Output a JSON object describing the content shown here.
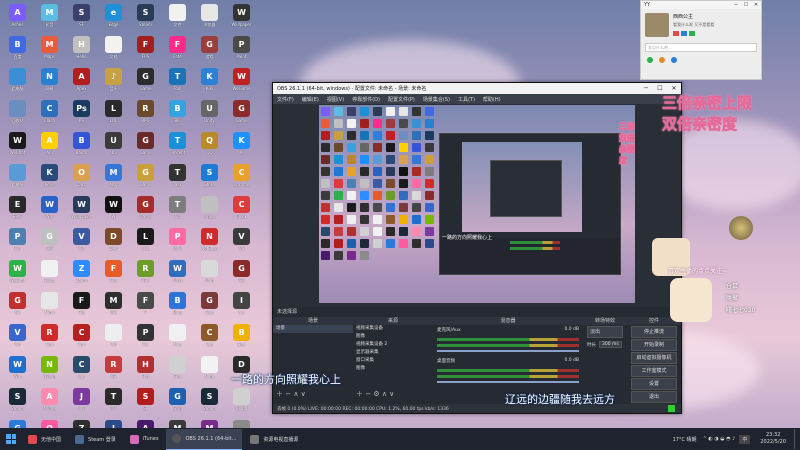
{
  "desktop_icons": [
    {
      "label": "Ashes",
      "color": "#7a5cff",
      "glyph": "A"
    },
    {
      "label": "初音",
      "color": "#5bbde2",
      "glyph": "M"
    },
    {
      "label": "SF",
      "color": "#3a3f6b",
      "glyph": "S"
    },
    {
      "label": "Edge",
      "color": "#1f8fd6",
      "glyph": "e"
    },
    {
      "label": "Steam",
      "color": "#2a3c55",
      "glyph": "S"
    },
    {
      "label": "文件",
      "color": "#f1f1f1",
      "glyph": ""
    },
    {
      "label": "浏览器",
      "color": "#e6e6e6",
      "glyph": ""
    },
    {
      "label": "Wallpaper",
      "color": "#333",
      "glyph": "W"
    },
    {
      "label": "百度",
      "color": "#4169e1",
      "glyph": "B"
    },
    {
      "label": "Maps",
      "color": "#e85b3c",
      "glyph": "M"
    },
    {
      "label": "Hello",
      "color": "#c0c0c0",
      "glyph": "H"
    },
    {
      "label": "文档",
      "color": "#f2f2f2",
      "glyph": ""
    },
    {
      "label": "FPS",
      "color": "#a02020",
      "glyph": "F"
    },
    {
      "label": "Fate",
      "color": "#ff2b8a",
      "glyph": "F"
    },
    {
      "label": "游戏",
      "color": "#9b3d3d",
      "glyph": "G"
    },
    {
      "label": "Paint",
      "color": "#4a4a4a",
      "glyph": "P"
    },
    {
      "label": "此电脑",
      "color": "#3c8fd6",
      "glyph": ""
    },
    {
      "label": "网易",
      "color": "#2a7fd1",
      "glyph": "N"
    },
    {
      "label": "Apex",
      "color": "#b21e1e",
      "glyph": "A"
    },
    {
      "label": "音乐",
      "color": "#c7a043",
      "glyph": "♪"
    },
    {
      "label": "Game",
      "color": "#2c2c2c",
      "glyph": "G"
    },
    {
      "label": "Tool",
      "color": "#1a73b8",
      "glyph": "T"
    },
    {
      "label": "Kiki",
      "color": "#2e7fd6",
      "glyph": "K"
    },
    {
      "label": "WeGame",
      "color": "#c02020",
      "glyph": "W"
    },
    {
      "label": "回收站",
      "color": "#6c8dbf",
      "glyph": ""
    },
    {
      "label": "Clash",
      "color": "#2d6fb8",
      "glyph": "C"
    },
    {
      "label": "PS",
      "color": "#1a3a5e",
      "glyph": "Ps"
    },
    {
      "label": "LOL",
      "color": "#2a2a2a",
      "glyph": "L"
    },
    {
      "label": "RPG",
      "color": "#6a4a2a",
      "glyph": "R"
    },
    {
      "label": "Bili",
      "color": "#36a3e0",
      "glyph": "B"
    },
    {
      "label": "Unity",
      "color": "#666",
      "glyph": "U"
    },
    {
      "label": "Game",
      "color": "#8c2b2b",
      "glyph": "G"
    },
    {
      "label": "WeChat",
      "color": "#1a1a1a",
      "glyph": "W"
    },
    {
      "label": "Ani",
      "color": "#ffd000",
      "glyph": "A"
    },
    {
      "label": "Baidu",
      "color": "#3555d9",
      "glyph": "B"
    },
    {
      "label": "Ubi",
      "color": "#3a3a3a",
      "glyph": "U"
    },
    {
      "label": "Game",
      "color": "#6b2a2a",
      "glyph": "G"
    },
    {
      "label": "Tencent",
      "color": "#1b8fd8",
      "glyph": "T"
    },
    {
      "label": "QQ",
      "color": "#b88a2a",
      "glyph": "Q"
    },
    {
      "label": "K",
      "color": "#1e90ff",
      "glyph": "K"
    },
    {
      "label": "此电脑",
      "color": "#5a9bd6",
      "glyph": ""
    },
    {
      "label": "Keys",
      "color": "#2a4a7a",
      "glyph": "K"
    },
    {
      "label": "Oriz",
      "color": "#d8a050",
      "glyph": "O"
    },
    {
      "label": "Msg",
      "color": "#3477d9",
      "glyph": "M"
    },
    {
      "label": "Game",
      "color": "#c9a03a",
      "glyph": "G"
    },
    {
      "label": "Task",
      "color": "#333",
      "glyph": "T"
    },
    {
      "label": "Store",
      "color": "#1f7ad6",
      "glyph": "S"
    },
    {
      "label": "Chrome",
      "color": "#e9a12b",
      "glyph": "C"
    },
    {
      "label": "EPIC",
      "color": "#2a2a2a",
      "glyph": "E"
    },
    {
      "label": "Win",
      "color": "#2962c7",
      "glyph": "W"
    },
    {
      "label": "Wallpaper",
      "color": "#2a3a5a",
      "glyph": "W"
    },
    {
      "label": "W",
      "color": "#111",
      "glyph": "W"
    },
    {
      "label": "Game",
      "color": "#a62b2b",
      "glyph": "G"
    },
    {
      "label": "Toc",
      "color": "#7d7d7d",
      "glyph": "T"
    },
    {
      "label": "Apps",
      "color": "#bfbfbf",
      "glyph": ""
    },
    {
      "label": "Clock",
      "color": "#dc3c3c",
      "glyph": "C"
    },
    {
      "label": "Pic",
      "color": "#4e7fb3",
      "glyph": "P"
    },
    {
      "label": "GW",
      "color": "#c0c0c0",
      "glyph": "G"
    },
    {
      "label": "Vis",
      "color": "#3c5aa0",
      "glyph": "V"
    },
    {
      "label": "Dev",
      "color": "#7a4a2a",
      "glyph": "D"
    },
    {
      "label": "LOL",
      "color": "#1a1a1a",
      "glyph": "L"
    },
    {
      "label": "Pink",
      "color": "#ff6aa0",
      "glyph": "P"
    },
    {
      "label": "NetEase",
      "color": "#d02b2b",
      "glyph": "N"
    },
    {
      "label": "VS",
      "color": "#3a3a3a",
      "glyph": "V"
    },
    {
      "label": "WeChat",
      "color": "#2bb34a",
      "glyph": "W"
    },
    {
      "label": "Docs",
      "color": "#f0f0f0",
      "glyph": ""
    },
    {
      "label": "Zoom",
      "color": "#2d8cff",
      "glyph": "Z"
    },
    {
      "label": "Fire",
      "color": "#e65b28",
      "glyph": "F"
    },
    {
      "label": "RTX",
      "color": "#6d9c2a",
      "glyph": "R"
    },
    {
      "label": "Wnd",
      "color": "#2f6dbf",
      "glyph": "W"
    },
    {
      "label": "Plan",
      "color": "#d9d9d9",
      "glyph": ""
    },
    {
      "label": "GG",
      "color": "#8a2a2a",
      "glyph": "G"
    },
    {
      "label": "G6",
      "color": "#c0302f",
      "glyph": "G"
    },
    {
      "label": "Mind",
      "color": "#e6e6e6",
      "glyph": ""
    },
    {
      "label": "File",
      "color": "#1a1a1a",
      "glyph": "F"
    },
    {
      "label": "MG",
      "color": "#2e2e2e",
      "glyph": "M"
    },
    {
      "label": "F",
      "color": "#4a4a4a",
      "glyph": "F"
    },
    {
      "label": "Blue",
      "color": "#2f73d6",
      "glyph": "B"
    },
    {
      "label": "Geo",
      "color": "#7a3a3a",
      "glyph": "G"
    },
    {
      "label": "Ice",
      "color": "#444",
      "glyph": "I"
    },
    {
      "label": "Vid",
      "color": "#3a66cc",
      "glyph": "V"
    },
    {
      "label": "Red",
      "color": "#d02b2b",
      "glyph": "R"
    },
    {
      "label": "Con",
      "color": "#b52020",
      "glyph": "C"
    },
    {
      "label": "Vid",
      "color": "#eee",
      "glyph": ""
    },
    {
      "label": "Pix",
      "color": "#333",
      "glyph": "P"
    },
    {
      "label": "Mus",
      "color": "#f0f0f0",
      "glyph": ""
    },
    {
      "label": "Cat",
      "color": "#8a5a2a",
      "glyph": "C"
    },
    {
      "label": "Bee",
      "color": "#f0b000",
      "glyph": "B"
    },
    {
      "label": "Win",
      "color": "#1f6fd0",
      "glyph": "W"
    },
    {
      "label": "Nvidia",
      "color": "#76b900",
      "glyph": "N"
    },
    {
      "label": "Car",
      "color": "#2a4a6a",
      "glyph": "C"
    },
    {
      "label": "RB",
      "color": "#c63c3c",
      "glyph": "R"
    },
    {
      "label": "Hat",
      "color": "#b03030",
      "glyph": "H"
    },
    {
      "label": "Fire",
      "color": "#d0d0d0",
      "glyph": ""
    },
    {
      "label": "Note",
      "color": "#f2f2f2",
      "glyph": ""
    },
    {
      "label": "D",
      "color": "#2a2a2a",
      "glyph": "D"
    },
    {
      "label": "Steam",
      "color": "#1b2838",
      "glyph": "S"
    },
    {
      "label": "Anime",
      "color": "#ff8ab0",
      "glyph": "A"
    },
    {
      "label": "Joy",
      "color": "#7a3aa0",
      "glyph": "J"
    },
    {
      "label": "TV",
      "color": "#2a2a2a",
      "glyph": "T"
    },
    {
      "label": "SF",
      "color": "#b01e1e",
      "glyph": "S"
    },
    {
      "label": "Grid",
      "color": "#1d5fb0",
      "glyph": "G"
    },
    {
      "label": "Steam",
      "color": "#1b2838",
      "glyph": "S"
    },
    {
      "label": "Cloud",
      "color": "#d0d0d0",
      "glyph": ""
    },
    {
      "label": "Gal",
      "color": "#2a7ad6",
      "glyph": "G"
    },
    {
      "label": "QQ",
      "color": "#ff5aa0",
      "glyph": "Q"
    },
    {
      "label": "Zel",
      "color": "#2e2e2e",
      "glyph": "Z"
    },
    {
      "label": "Ins",
      "color": "#2a4a8a",
      "glyph": "I"
    },
    {
      "label": "AE",
      "color": "#4a1a6a",
      "glyph": "A"
    },
    {
      "label": "MW",
      "color": "#3a3a3a",
      "glyph": "M"
    },
    {
      "label": "Mix",
      "color": "#7a2a8a",
      "glyph": "M"
    },
    {
      "label": "Blank",
      "color": "#8a8a8a",
      "glyph": ""
    }
  ],
  "obs": {
    "title": "OBS 26.1.1 (64-bit, windows) - 配置文件: 未命名 - 场景: 未命名",
    "menu": [
      "文件(F)",
      "编辑(E)",
      "视图(V)",
      "停靠部件(D)",
      "配置文件(P)",
      "场景集合(S)",
      "工具(T)",
      "帮助(H)"
    ],
    "docks": {
      "scenes": {
        "title": "场景",
        "items": [
          "场景"
        ]
      },
      "sources": {
        "title": "来源",
        "items": [
          "视频采集设备",
          "图像",
          "视频采集设备 2",
          "显示器采集",
          "窗口采集",
          "图像"
        ]
      },
      "mixer": {
        "title": "混音器",
        "tracks": [
          {
            "name": "麦克风/Aux",
            "db": "0.0 dB"
          },
          {
            "name": "桌面音频",
            "db": "0.0 dB"
          }
        ]
      },
      "transitions": {
        "title": "转场特效",
        "type": "淡出",
        "duration_label": "时长",
        "duration": "300 ms"
      },
      "controls": {
        "title": "控件",
        "buttons": [
          "停止推流",
          "开始录制",
          "启动虚拟摄像机",
          "工作室模式",
          "设置",
          "退出"
        ]
      }
    },
    "status": "丢帧 0 (0.0%)   LIVE: 00:00:00   REC: 00:00:00   CPU: 1.2%, 60.00 fps   kb/s: 1336"
  },
  "chat": {
    "title": "YY",
    "name": "西西公主",
    "line1": "看我什么呢 又不是看看",
    "input_placeholder": "发点什么吧..."
  },
  "overlay": {
    "big_line1": "三倍亲密上限",
    "big_line2": "双倍亲密度",
    "small_line1": "三倍亲密上限",
    "small_line2": "双倍亲密度",
    "follow_text": "喜欢主播的点点关注~",
    "fans": [
      "仓鼠",
      "魔聚",
      "曙七七030"
    ],
    "subtitle_left": "一路的方向照耀我心上",
    "subtitle_right": "辽远的边疆随我去远方",
    "nested_subtitle": "一路的方向照耀我心上"
  },
  "taskbar": {
    "items": [
      {
        "label": "无他中国",
        "color": "#e04b4b"
      },
      {
        "label": "Steam 登录",
        "color": "#1b2838"
      },
      {
        "label": "iTunes",
        "color": "#d86ab8"
      },
      {
        "label": "OBS 26.1.1 (64-bit...",
        "color": "#333"
      },
      {
        "label": "资源电视直播源",
        "color": "#444"
      }
    ],
    "weather": "17°C 晴朗",
    "ime": "中",
    "time": "23:32",
    "date": "2022/5/20"
  }
}
